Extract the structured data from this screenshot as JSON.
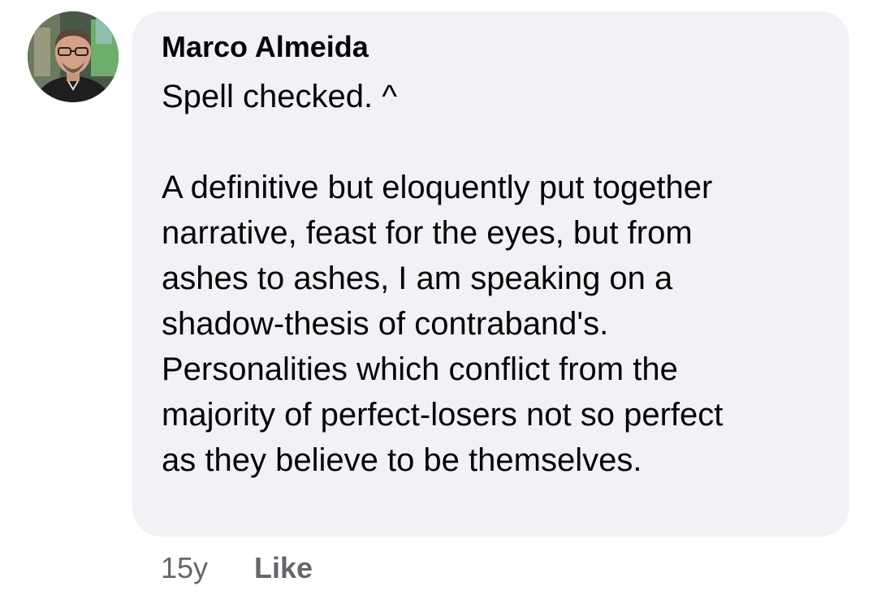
{
  "comment": {
    "author": "Marco Almeida",
    "lines": [
      "Spell checked. ^",
      "",
      "A definitive but eloquently put together",
      "narrative, feast for the eyes, but from",
      "ashes to ashes, I am speaking on a",
      "shadow-thesis of contraband's.",
      "Personalities which conflict from the",
      "majority of perfect-losers not so perfect",
      "as they believe to be themselves."
    ],
    "timestamp": "15y",
    "like_label": "Like"
  },
  "colors": {
    "bubble_bg": "#f0f2f5",
    "text": "#050505",
    "secondary_text": "#65676b"
  }
}
